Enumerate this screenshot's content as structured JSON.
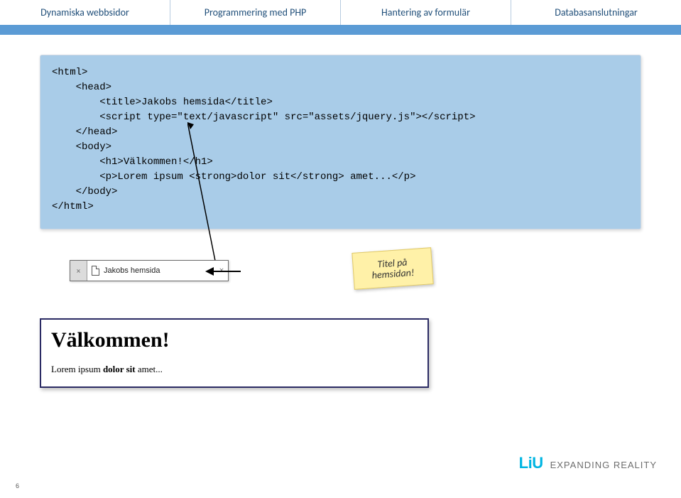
{
  "tabs": {
    "items": [
      {
        "label": "Dynamiska webbsidor"
      },
      {
        "label": "Programmering med PHP"
      },
      {
        "label": "Hantering av formulär"
      },
      {
        "label": "Databasanslutningar"
      }
    ]
  },
  "code": {
    "l1": "<html>",
    "l2": "    <head>",
    "l3": "        <title>Jakobs hemsida</title>",
    "l4": "        <script type=\"text/javascript\" src=\"assets/jquery.js\"></script>",
    "l5": "    </head>",
    "l6": "    <body>",
    "l7": "        <h1>Välkommen!</h1>",
    "l8": "        <p>Lorem ipsum <strong>dolor sit</strong> amet...</p>",
    "l9": "    </body>",
    "l10": "</html>"
  },
  "browser_tab": {
    "ghost_x": "×",
    "label": "Jakobs hemsida",
    "close_x": "×"
  },
  "sticky": {
    "line1": "Titel på",
    "line2": "hemsidan!"
  },
  "render": {
    "h1": "Välkommen!",
    "p_pre": "Lorem ipsum ",
    "p_bold": "dolor sit",
    "p_post": " amet..."
  },
  "footer": {
    "brand": "LiU",
    "tagline": "EXPANDING REALITY"
  },
  "page_number": "6"
}
